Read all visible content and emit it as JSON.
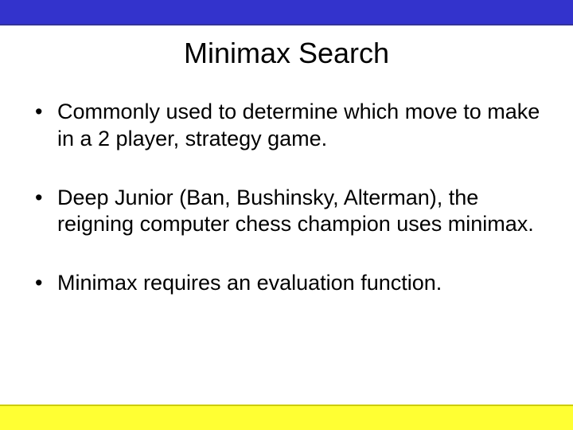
{
  "title": "Minimax Search",
  "bullets": [
    "Commonly used to determine which move to make in a 2 player, strategy game.",
    "Deep Junior (Ban, Bushinsky, Alterman), the reigning computer chess champion uses minimax.",
    "Minimax requires an evaluation function."
  ]
}
